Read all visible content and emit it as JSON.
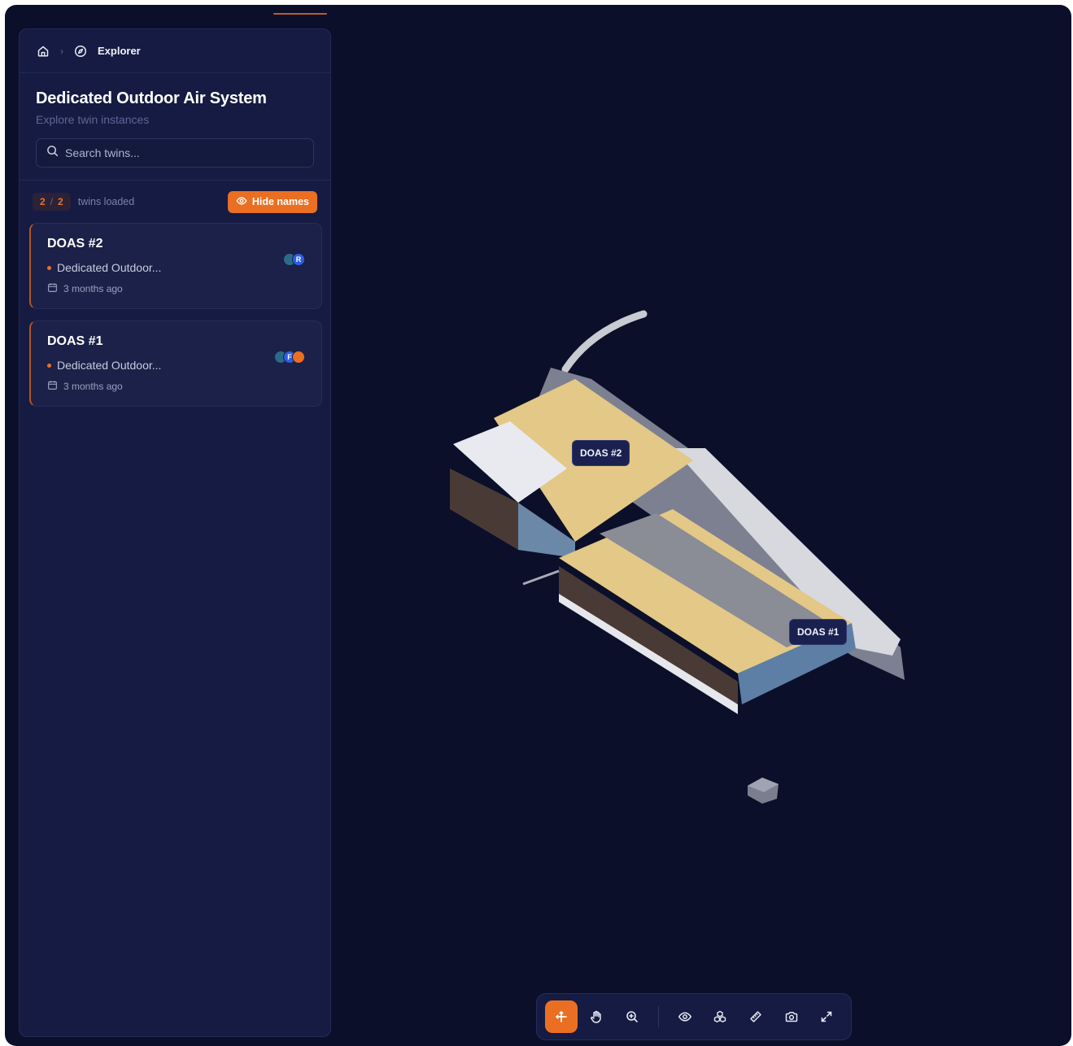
{
  "breadcrumb": {
    "home_icon": "home-icon",
    "current_icon": "compass-icon",
    "current": "Explorer"
  },
  "header": {
    "title": "Dedicated Outdoor Air System",
    "subtitle": "Explore twin instances"
  },
  "search": {
    "placeholder": "Search twins..."
  },
  "status": {
    "loaded": "2",
    "total": "2",
    "loaded_label": "twins loaded",
    "toggle_label": "Hide names"
  },
  "twins": [
    {
      "name": "DOAS #2",
      "type": "Dedicated Outdoor...",
      "time": "3 months ago",
      "avatars": [
        "R"
      ]
    },
    {
      "name": "DOAS #1",
      "type": "Dedicated Outdoor...",
      "time": "3 months ago",
      "avatars": [
        "F"
      ]
    }
  ],
  "viewer": {
    "labels": [
      "DOAS #2",
      "DOAS #1"
    ]
  },
  "toolbar": [
    "orbit-icon",
    "pan-icon",
    "zoom-icon",
    "visibility-icon",
    "explode-icon",
    "measure-icon",
    "camera-icon",
    "fullscreen-icon"
  ],
  "colors": {
    "accent": "#ea6f22",
    "background": "#0b0f2a",
    "panel": "#151b42"
  }
}
